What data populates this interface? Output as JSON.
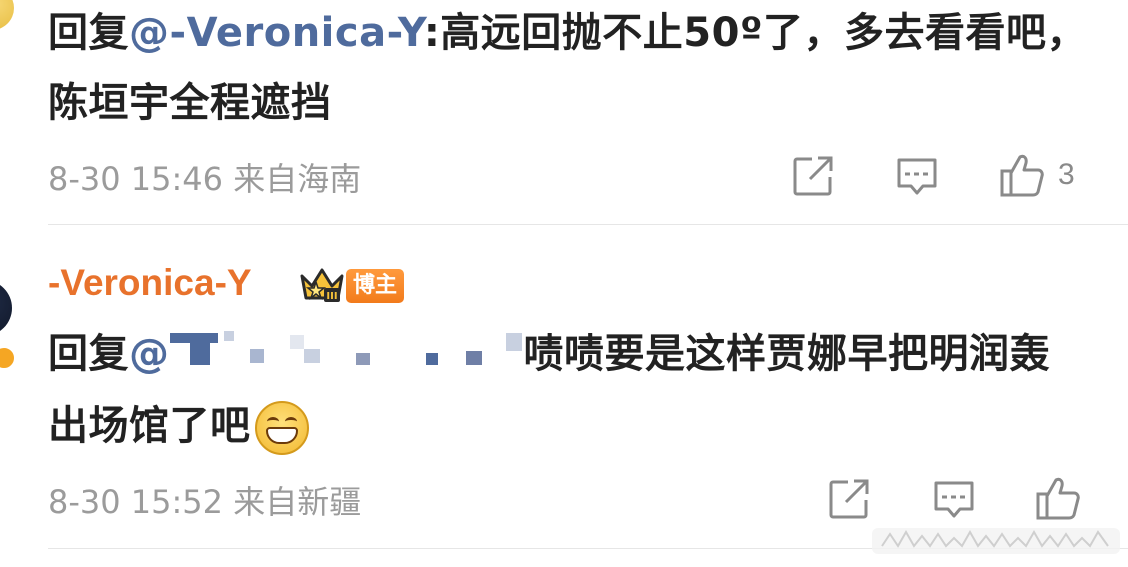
{
  "comments": [
    {
      "reply_prefix": "回复",
      "mention": "@-Veronica-Y",
      "body": ":高远回抛不止50º了，多去看看吧，陈垣宇全程遮挡",
      "date": "8-30 15:46",
      "location": "来自海南",
      "likes": "3"
    },
    {
      "username": "-Veronica-Y",
      "author_badge": "博主",
      "reply_prefix": "回复",
      "mention": "@",
      "body": "啧啧要是这样贾娜早把明润轰出场馆了吧",
      "date": "8-30 15:52",
      "location": "来自新疆",
      "likes": ""
    }
  ],
  "icons": {
    "share": "share-icon",
    "comment": "comment-icon",
    "like": "thumbs-up-icon",
    "crown": "crown-icon",
    "emoji": "grin-emoji-icon"
  },
  "colors": {
    "username": "#e8722c",
    "mention": "#4f6b9d",
    "meta": "#9b9b9b",
    "badge": "#f27b1c"
  }
}
